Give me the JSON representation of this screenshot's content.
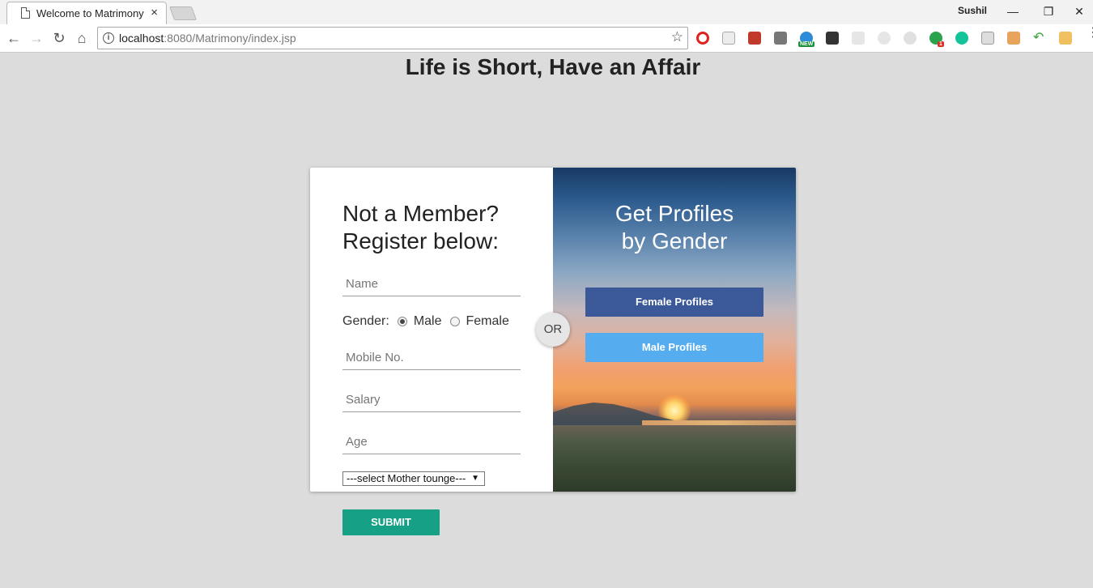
{
  "browser": {
    "tab_title": "Welcome to Matrimony",
    "tab_close": "×",
    "profile_name": "Sushil",
    "url_host": "localhost",
    "url_rest": ":8080/Matrimony/index.jsp",
    "extension_badges": {
      "new": "NEW",
      "count": "1"
    },
    "icons": [
      "back-icon",
      "forward-icon",
      "reload-icon",
      "home-icon",
      "info-icon",
      "star-icon",
      "menu-icon"
    ]
  },
  "page": {
    "heading": "Life is Short, Have an Affair"
  },
  "register": {
    "title_line1": "Not a Member?",
    "title_line2": "Register below:",
    "name_placeholder": "Name",
    "gender_label": "Gender:",
    "gender_options": [
      "Male",
      "Female"
    ],
    "gender_selected": "Male",
    "mobile_placeholder": "Mobile No.",
    "salary_placeholder": "Salary",
    "age_placeholder": "Age",
    "mother_tongue_selected": "---select Mother tounge---",
    "submit_label": "SUBMIT"
  },
  "divider": {
    "label": "OR"
  },
  "profiles": {
    "title_line1": "Get Profiles",
    "title_line2": "by Gender",
    "female_button": "Female Profiles",
    "male_button": "Male Profiles"
  },
  "colors": {
    "page_bg": "#dcdcdc",
    "female_button": "#3b5998",
    "male_button": "#55acee",
    "submit_button": "#16a085"
  }
}
